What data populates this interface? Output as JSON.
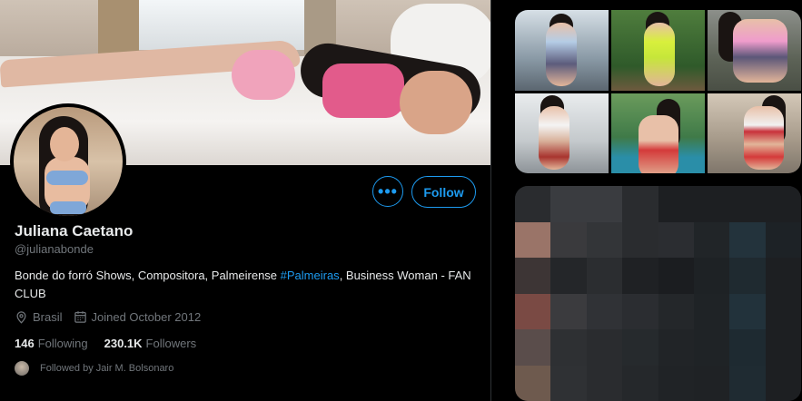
{
  "profile": {
    "name": "Juliana Caetano",
    "handle": "@julianabonde",
    "bio_plain_1": "Bonde do forró Shows, Compositora, Palmeirense ",
    "bio_tag": "#Palmeiras",
    "bio_plain_2": ", Business Woman - FAN CLUB",
    "location": "Brasil",
    "joined": "Joined October 2012",
    "following_count": "146",
    "following_label": "Following",
    "followers_count": "230.1K",
    "followers_label": "Followers",
    "followed_by": "Followed by Jair M. Bolsonaro"
  },
  "actions": {
    "more_label": "•••",
    "follow_label": "Follow"
  },
  "colors": {
    "accent": "#1d9bf0",
    "background": "#000000",
    "secondary_text": "#71767b"
  },
  "icons": {
    "location": "location-pin-icon",
    "calendar": "calendar-icon",
    "more": "more-dots-icon"
  }
}
